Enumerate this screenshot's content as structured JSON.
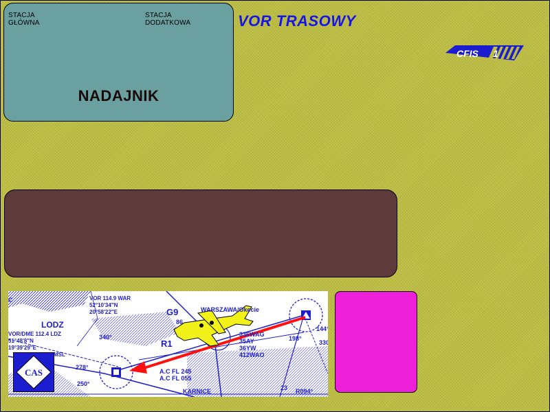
{
  "station": {
    "main_label": "STACJA\nGŁÓWNA",
    "extra_label": "STACJA\nDODATKOWA",
    "transmitter": "NADAJNIK"
  },
  "title": "VOR TRASOWY",
  "logo": {
    "cfis_text": "CFIS",
    "cfis_number": "1",
    "cas_text": "CAS"
  },
  "map": {
    "lodz_name": "LODZ",
    "lodz_info": "VOR/DME 112.4 LDZ\n51°48'8\"N\n19°39'29\"E",
    "lodz_msl": "MSL",
    "war_info": "VOR 114.9 WAR\n52°10'34\"N\n20°58'22\"E",
    "warszawa": "WARSZAWA/Okecie",
    "airway_g": "G9",
    "airway_r": "R1",
    "fl_info": "A.C FL 245\nA.C FL 055",
    "routes": "336WAG\n35AY\n36YW\n412WAO",
    "karnice": "KARNICE",
    "r094": "R094°",
    "c_label": "C",
    "bearing_278": "278°",
    "bearing_250": "250°",
    "bearing_340": "340°",
    "bearing_198": "198°",
    "bearing_330": "330°",
    "bearing_144": "144°",
    "num_86": "86",
    "num_23": "23"
  },
  "colors": {
    "background": "#bdbd42",
    "station_panel": "#6aa0a0",
    "title": "#1515e8",
    "brown_panel": "#5e3a3a",
    "magenta_panel": "#ee1fd8",
    "map_ink": "#1d1dd0",
    "route_arrow": "#ff1010",
    "aircraft": "#f2f21a"
  },
  "icons": [
    "cfis-logo-icon",
    "cas-logo-icon",
    "aircraft-icon",
    "vor-station-icon",
    "route-arrow-icon"
  ]
}
